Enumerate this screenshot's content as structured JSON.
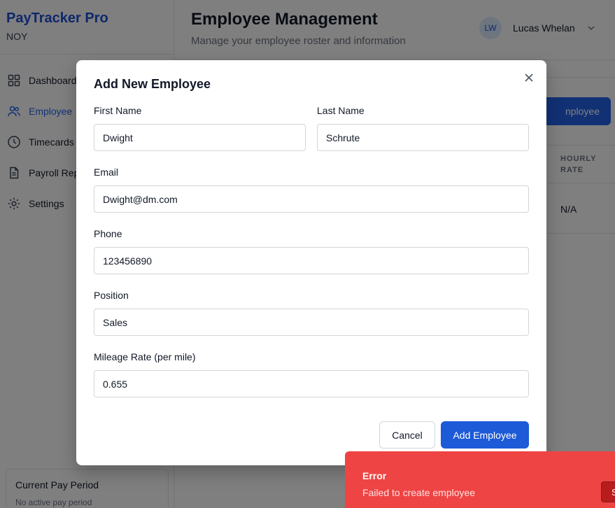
{
  "app": {
    "name": "PayTracker Pro",
    "org": "NOY"
  },
  "sidebar": {
    "items": [
      {
        "label": "Dashboard",
        "icon": "dashboard-icon"
      },
      {
        "label": "Employee",
        "icon": "users-icon",
        "active": true
      },
      {
        "label": "Timecards",
        "icon": "clock-icon"
      },
      {
        "label": "Payroll Rep",
        "icon": "document-icon"
      },
      {
        "label": "Settings",
        "icon": "gear-icon"
      }
    ],
    "pay_period": {
      "title": "Current Pay Period",
      "subtitle": "No active pay period"
    }
  },
  "header": {
    "title": "Employee Management",
    "subtitle": "Manage your employee roster and information",
    "user": {
      "initials": "LW",
      "name": "Lucas Whelan"
    }
  },
  "background_content": {
    "add_button_label": "nployee",
    "column_header": "HOURLY RATE",
    "cell_value": "N/A"
  },
  "modal": {
    "title": "Add New Employee",
    "fields": {
      "first_name": {
        "label": "First Name",
        "value": "Dwight"
      },
      "last_name": {
        "label": "Last Name",
        "value": "Schrute"
      },
      "email": {
        "label": "Email",
        "value": "Dwight@dm.com"
      },
      "phone": {
        "label": "Phone",
        "value": "123456890"
      },
      "position": {
        "label": "Position",
        "value": "Sales"
      },
      "mileage_rate": {
        "label": "Mileage Rate (per mile)",
        "value": "0.655"
      }
    },
    "cancel_label": "Cancel",
    "submit_label": "Add Employee"
  },
  "toast": {
    "title": "Error",
    "message": "Failed to create employee",
    "action_label": "S"
  },
  "colors": {
    "brand": "#1d4ed8",
    "primary_button": "#1d5ad8",
    "error": "#ef4444"
  }
}
